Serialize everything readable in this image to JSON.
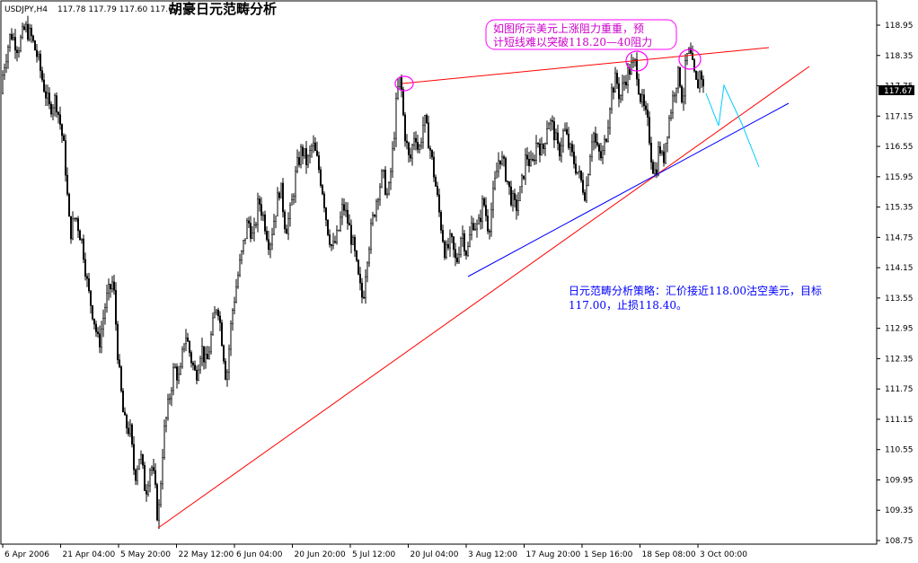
{
  "header": {
    "symbol": "USDJPY,H4",
    "ohlc": "117.78 117.79 117.60 117.67",
    "title": "胡豪日元范畴分析"
  },
  "current_price": "117.67",
  "annotations": {
    "resistance_note": [
      "如图所示美元上涨阻力重重，预",
      "计短线难以突破118.20—40阻力"
    ],
    "strategy_note": [
      "日元范畴分析策略：汇价接近118.00沽空美元，目标",
      "117.00，止损118.40。"
    ]
  },
  "colors": {
    "candle": "#000000",
    "resistance_line": "#ff0000",
    "support_red": "#ff0000",
    "support_blue": "#0000ff",
    "projection": "#00ccff",
    "circle": "#ff00ff"
  },
  "chart_data": {
    "type": "candlestick",
    "symbol": "USDJPY",
    "timeframe": "H4",
    "ylim": [
      108.75,
      119.2
    ],
    "y_ticks": [
      "118.95",
      "118.35",
      "117.75",
      "117.15",
      "116.55",
      "115.95",
      "115.35",
      "114.75",
      "114.15",
      "113.55",
      "112.95",
      "112.35",
      "111.75",
      "111.15",
      "110.55",
      "109.95",
      "109.35",
      "108.75"
    ],
    "x_ticks": [
      "6 Apr 2006",
      "21 Apr 04:00",
      "5 May 20:00",
      "22 May 12:00",
      "6 Jun 04:00",
      "20 Jun 20:00",
      "5 Jul 12:00",
      "20 Jul 04:00",
      "3 Aug 12:00",
      "17 Aug 20:00",
      "1 Sep 16:00",
      "18 Sep 08:00",
      "3 Oct 00:00"
    ],
    "price_path": [
      [
        0,
        117.6
      ],
      [
        5,
        118.2
      ],
      [
        12,
        118.8
      ],
      [
        20,
        118.5
      ],
      [
        28,
        118.9
      ],
      [
        35,
        118.7
      ],
      [
        42,
        118.3
      ],
      [
        48,
        117.8
      ],
      [
        55,
        117.3
      ],
      [
        62,
        117.5
      ],
      [
        68,
        116.9
      ],
      [
        72,
        116.4
      ],
      [
        74,
        115.8
      ],
      [
        78,
        114.8
      ],
      [
        84,
        115.2
      ],
      [
        92,
        114.6
      ],
      [
        98,
        113.7
      ],
      [
        104,
        113.2
      ],
      [
        110,
        112.6
      ],
      [
        118,
        113.5
      ],
      [
        126,
        113.9
      ],
      [
        132,
        112.2
      ],
      [
        138,
        111.1
      ],
      [
        145,
        110.9
      ],
      [
        150,
        110.0
      ],
      [
        156,
        110.5
      ],
      [
        162,
        109.7
      ],
      [
        168,
        110.3
      ],
      [
        172,
        109.9
      ],
      [
        176,
        109.1
      ],
      [
        182,
        110.8
      ],
      [
        188,
        111.5
      ],
      [
        194,
        112.2
      ],
      [
        200,
        111.9
      ],
      [
        206,
        112.9
      ],
      [
        212,
        112.4
      ],
      [
        218,
        112.0
      ],
      [
        224,
        112.6
      ],
      [
        230,
        112.2
      ],
      [
        236,
        112.9
      ],
      [
        242,
        113.5
      ],
      [
        248,
        112.6
      ],
      [
        252,
        111.9
      ],
      [
        258,
        113.2
      ],
      [
        264,
        113.9
      ],
      [
        270,
        114.5
      ],
      [
        276,
        115.1
      ],
      [
        282,
        114.7
      ],
      [
        288,
        115.5
      ],
      [
        294,
        115.1
      ],
      [
        300,
        114.6
      ],
      [
        306,
        115.2
      ],
      [
        312,
        115.8
      ],
      [
        318,
        114.9
      ],
      [
        324,
        115.3
      ],
      [
        330,
        116.1
      ],
      [
        336,
        116.5
      ],
      [
        342,
        116.2
      ],
      [
        348,
        116.6
      ],
      [
        354,
        116.2
      ],
      [
        360,
        115.6
      ],
      [
        364,
        115.0
      ],
      [
        370,
        114.5
      ],
      [
        376,
        114.8
      ],
      [
        382,
        115.4
      ],
      [
        388,
        115.0
      ],
      [
        394,
        114.5
      ],
      [
        400,
        113.8
      ],
      [
        404,
        113.5
      ],
      [
        408,
        114.3
      ],
      [
        414,
        115.0
      ],
      [
        420,
        115.6
      ],
      [
        426,
        116.0
      ],
      [
        432,
        115.5
      ],
      [
        438,
        116.6
      ],
      [
        442,
        117.6
      ],
      [
        446,
        117.9
      ],
      [
        450,
        116.9
      ],
      [
        456,
        116.2
      ],
      [
        462,
        116.9
      ],
      [
        466,
        116.4
      ],
      [
        472,
        117.1
      ],
      [
        478,
        116.6
      ],
      [
        484,
        115.9
      ],
      [
        490,
        115.1
      ],
      [
        496,
        114.4
      ],
      [
        502,
        114.7
      ],
      [
        508,
        114.2
      ],
      [
        514,
        114.9
      ],
      [
        520,
        114.4
      ],
      [
        526,
        115.1
      ],
      [
        532,
        114.9
      ],
      [
        538,
        115.5
      ],
      [
        544,
        114.9
      ],
      [
        550,
        115.7
      ],
      [
        556,
        116.4
      ],
      [
        562,
        116.1
      ],
      [
        568,
        115.6
      ],
      [
        574,
        115.3
      ],
      [
        580,
        115.7
      ],
      [
        586,
        116.4
      ],
      [
        592,
        116.1
      ],
      [
        598,
        116.7
      ],
      [
        604,
        116.4
      ],
      [
        610,
        117.1
      ],
      [
        616,
        116.9
      ],
      [
        622,
        116.4
      ],
      [
        628,
        116.9
      ],
      [
        634,
        116.5
      ],
      [
        640,
        116.2
      ],
      [
        646,
        115.9
      ],
      [
        652,
        115.6
      ],
      [
        656,
        116.3
      ],
      [
        660,
        116.9
      ],
      [
        664,
        116.5
      ],
      [
        670,
        116.3
      ],
      [
        676,
        116.9
      ],
      [
        680,
        117.6
      ],
      [
        686,
        117.9
      ],
      [
        690,
        117.5
      ],
      [
        696,
        117.9
      ],
      [
        702,
        118.1
      ],
      [
        708,
        118.2
      ],
      [
        712,
        117.6
      ],
      [
        718,
        117.2
      ],
      [
        722,
        116.9
      ],
      [
        726,
        116.2
      ],
      [
        730,
        116.0
      ],
      [
        734,
        116.6
      ],
      [
        738,
        116.2
      ],
      [
        742,
        116.8
      ],
      [
        748,
        117.4
      ],
      [
        752,
        117.8
      ],
      [
        756,
        118.0
      ],
      [
        760,
        117.4
      ],
      [
        764,
        118.3
      ],
      [
        768,
        118.4
      ],
      [
        772,
        118.0
      ],
      [
        776,
        117.7
      ],
      [
        780,
        118.1
      ],
      [
        783,
        117.67
      ]
    ]
  }
}
